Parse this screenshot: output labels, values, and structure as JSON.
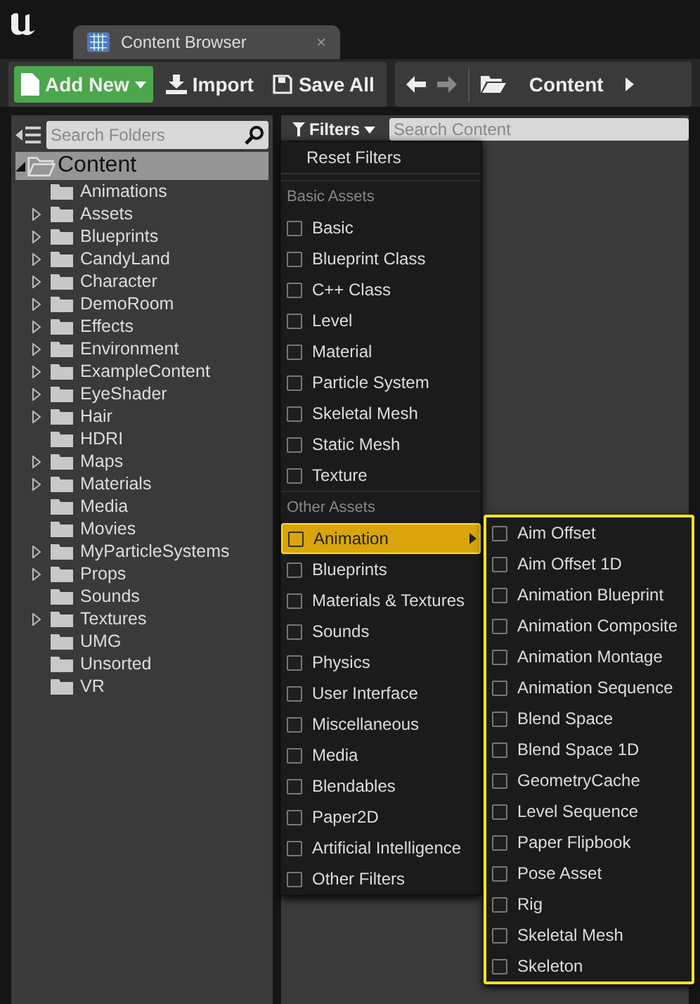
{
  "tab": {
    "title": "Content Browser",
    "close": "×"
  },
  "toolbar": {
    "buttons": [
      {
        "kind": "add",
        "label": "Add New"
      },
      {
        "kind": "import",
        "label": "Import"
      },
      {
        "kind": "save",
        "label": "Save All"
      }
    ],
    "path": "Content"
  },
  "folders": {
    "search_placeholder": "Search Folders",
    "tree": [
      {
        "name": "Content",
        "expanded": true,
        "selected": true,
        "children": [
          {
            "name": "Animations",
            "expandable": false
          },
          {
            "name": "Assets",
            "expandable": true
          },
          {
            "name": "Blueprints",
            "expandable": true
          },
          {
            "name": "CandyLand",
            "expandable": true
          },
          {
            "name": "Character",
            "expandable": true
          },
          {
            "name": "DemoRoom",
            "expandable": true
          },
          {
            "name": "Effects",
            "expandable": true
          },
          {
            "name": "Environment",
            "expandable": true
          },
          {
            "name": "ExampleContent",
            "expandable": true
          },
          {
            "name": "EyeShader",
            "expandable": true
          },
          {
            "name": "Hair",
            "expandable": true
          },
          {
            "name": "HDRI",
            "expandable": false
          },
          {
            "name": "Maps",
            "expandable": true
          },
          {
            "name": "Materials",
            "expandable": true
          },
          {
            "name": "Media",
            "expandable": false
          },
          {
            "name": "Movies",
            "expandable": false
          },
          {
            "name": "MyParticleSystems",
            "expandable": true
          },
          {
            "name": "Props",
            "expandable": true
          },
          {
            "name": "Sounds",
            "expandable": false
          },
          {
            "name": "Textures",
            "expandable": true
          },
          {
            "name": "UMG",
            "expandable": false
          },
          {
            "name": "Unsorted",
            "expandable": false
          },
          {
            "name": "VR",
            "expandable": false
          }
        ]
      }
    ]
  },
  "content": {
    "filters_label": "Filters",
    "search_placeholder": "Search Content"
  },
  "filter_menu": [
    {
      "kind": "action",
      "label": "Reset Filters"
    },
    {
      "kind": "header",
      "label": "Basic Assets"
    },
    {
      "kind": "check",
      "label": "Basic",
      "checked": false,
      "selected": false
    },
    {
      "kind": "check",
      "label": "Blueprint Class",
      "checked": false,
      "selected": false
    },
    {
      "kind": "check",
      "label": "C++ Class",
      "checked": false,
      "selected": false
    },
    {
      "kind": "check",
      "label": "Level",
      "checked": false,
      "selected": false
    },
    {
      "kind": "check",
      "label": "Material",
      "checked": false,
      "selected": false
    },
    {
      "kind": "check",
      "label": "Particle System",
      "checked": false,
      "selected": false
    },
    {
      "kind": "check",
      "label": "Skeletal Mesh",
      "checked": false,
      "selected": false
    },
    {
      "kind": "check",
      "label": "Static Mesh",
      "checked": false,
      "selected": false
    },
    {
      "kind": "check",
      "label": "Texture",
      "checked": false,
      "selected": false
    },
    {
      "kind": "header",
      "label": "Other Assets"
    },
    {
      "kind": "check",
      "label": "Animation",
      "checked": false,
      "selected": true,
      "submenu": true
    },
    {
      "kind": "check",
      "label": "Blueprints",
      "checked": false,
      "selected": false
    },
    {
      "kind": "check",
      "label": "Materials & Textures",
      "checked": false,
      "selected": false
    },
    {
      "kind": "check",
      "label": "Sounds",
      "checked": false,
      "selected": false
    },
    {
      "kind": "check",
      "label": "Physics",
      "checked": false,
      "selected": false
    },
    {
      "kind": "check",
      "label": "User Interface",
      "checked": false,
      "selected": false
    },
    {
      "kind": "check",
      "label": "Miscellaneous",
      "checked": false,
      "selected": false
    },
    {
      "kind": "check",
      "label": "Media",
      "checked": false,
      "selected": false
    },
    {
      "kind": "check",
      "label": "Blendables",
      "checked": false,
      "selected": false
    },
    {
      "kind": "check",
      "label": "Paper2D",
      "checked": false,
      "selected": false
    },
    {
      "kind": "check",
      "label": "Artificial Intelligence",
      "checked": false,
      "selected": false
    },
    {
      "kind": "check",
      "label": "Other Filters",
      "checked": false,
      "selected": false
    }
  ],
  "submenu": [
    {
      "label": "Aim Offset",
      "checked": false
    },
    {
      "label": "Aim Offset 1D",
      "checked": false
    },
    {
      "label": "Animation Blueprint",
      "checked": false
    },
    {
      "label": "Animation Composite",
      "checked": false
    },
    {
      "label": "Animation Montage",
      "checked": false
    },
    {
      "label": "Animation Sequence",
      "checked": false
    },
    {
      "label": "Blend Space",
      "checked": false
    },
    {
      "label": "Blend Space 1D",
      "checked": false
    },
    {
      "label": "GeometryCache",
      "checked": false
    },
    {
      "label": "Level Sequence",
      "checked": false
    },
    {
      "label": "Paper Flipbook",
      "checked": false
    },
    {
      "label": "Pose Asset",
      "checked": false
    },
    {
      "label": "Rig",
      "checked": false
    },
    {
      "label": "Skeletal Mesh",
      "checked": false
    },
    {
      "label": "Skeleton",
      "checked": false
    }
  ]
}
